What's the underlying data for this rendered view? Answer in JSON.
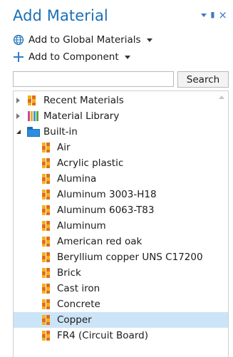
{
  "panel": {
    "title": "Add Material",
    "add_global": "Add to Global Materials",
    "add_component": "Add to Component"
  },
  "search": {
    "value": "",
    "placeholder": "",
    "button": "Search"
  },
  "tree": {
    "nodes": [
      {
        "label": "Recent Materials",
        "icon": "recent-materials-icon",
        "state": "collapsed"
      },
      {
        "label": "Material Library",
        "icon": "library-icon",
        "state": "collapsed"
      },
      {
        "label": "Built-in",
        "icon": "folder-icon",
        "state": "expanded"
      }
    ],
    "materials": [
      "Air",
      "Acrylic plastic",
      "Alumina",
      "Aluminum 3003-H18",
      "Aluminum 6063-T83",
      "Aluminum",
      "American red oak",
      "Beryllium copper UNS C17200",
      "Brick",
      "Cast iron",
      "Concrete",
      "Copper",
      "FR4 (Circuit Board)"
    ],
    "selected": "Copper"
  },
  "colors": {
    "title": "#1a6fb6",
    "selection": "#cce4f7",
    "accent": "#2f7fc8"
  }
}
